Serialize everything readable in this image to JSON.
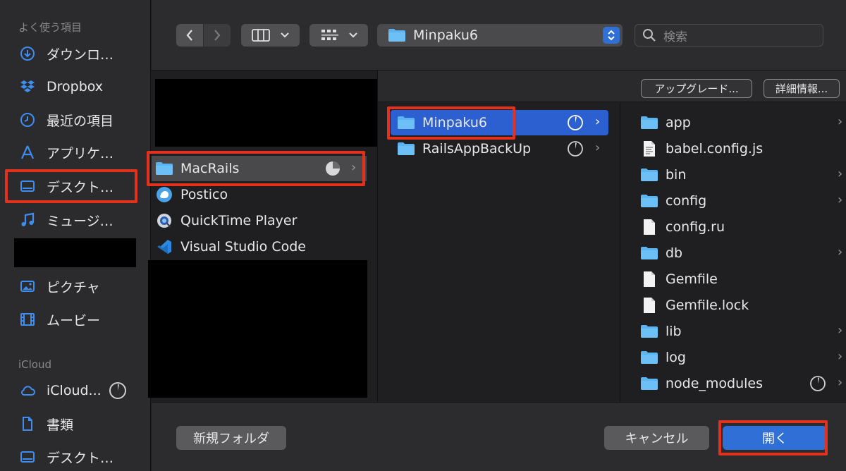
{
  "sidebar": {
    "favorites_title": "よく使う項目",
    "items": [
      {
        "label": "ダウンロ…",
        "icon": "download-icon"
      },
      {
        "label": "Dropbox",
        "icon": "dropbox-icon"
      },
      {
        "label": "最近の項目",
        "icon": "clock-icon"
      },
      {
        "label": "アプリケ…",
        "icon": "applications-icon"
      },
      {
        "label": "デスクト…",
        "icon": "desktop-icon"
      },
      {
        "label": "ミュージ…",
        "icon": "music-icon"
      },
      {
        "label": "ピクチャ",
        "icon": "pictures-icon"
      },
      {
        "label": "ムービー",
        "icon": "movies-icon"
      }
    ],
    "icloud_title": "iCloud",
    "icloud_items": [
      {
        "label": "iCloud...",
        "icon": "cloud-icon"
      },
      {
        "label": "書類",
        "icon": "document-icon"
      },
      {
        "label": "デスクト…",
        "icon": "desktop-icon"
      }
    ]
  },
  "toolbar": {
    "path_label": "Minpaku6",
    "search_placeholder": "検索"
  },
  "infobar": {
    "upgrade_label": "アップグレード...",
    "details_label": "詳細情報..."
  },
  "columns": {
    "col1": [
      "MacRails",
      "Postico",
      "QuickTime Player",
      "Visual Studio Code"
    ],
    "col2": [
      "Minpaku6",
      "RailsAppBackUp"
    ],
    "col3": [
      {
        "name": "app",
        "type": "folder"
      },
      {
        "name": "babel.config.js",
        "type": "file"
      },
      {
        "name": "bin",
        "type": "folder"
      },
      {
        "name": "config",
        "type": "folder"
      },
      {
        "name": "config.ru",
        "type": "file"
      },
      {
        "name": "db",
        "type": "folder"
      },
      {
        "name": "Gemfile",
        "type": "file"
      },
      {
        "name": "Gemfile.lock",
        "type": "file"
      },
      {
        "name": "lib",
        "type": "folder"
      },
      {
        "name": "log",
        "type": "folder"
      },
      {
        "name": "node_modules",
        "type": "folder"
      }
    ]
  },
  "bottom": {
    "new_folder_label": "新規フォルダ",
    "cancel_label": "キャンセル",
    "open_label": "開く"
  },
  "colors": {
    "accent": "#2f6fd6",
    "highlight": "#e2321d",
    "folder": "#5ab4f2"
  }
}
